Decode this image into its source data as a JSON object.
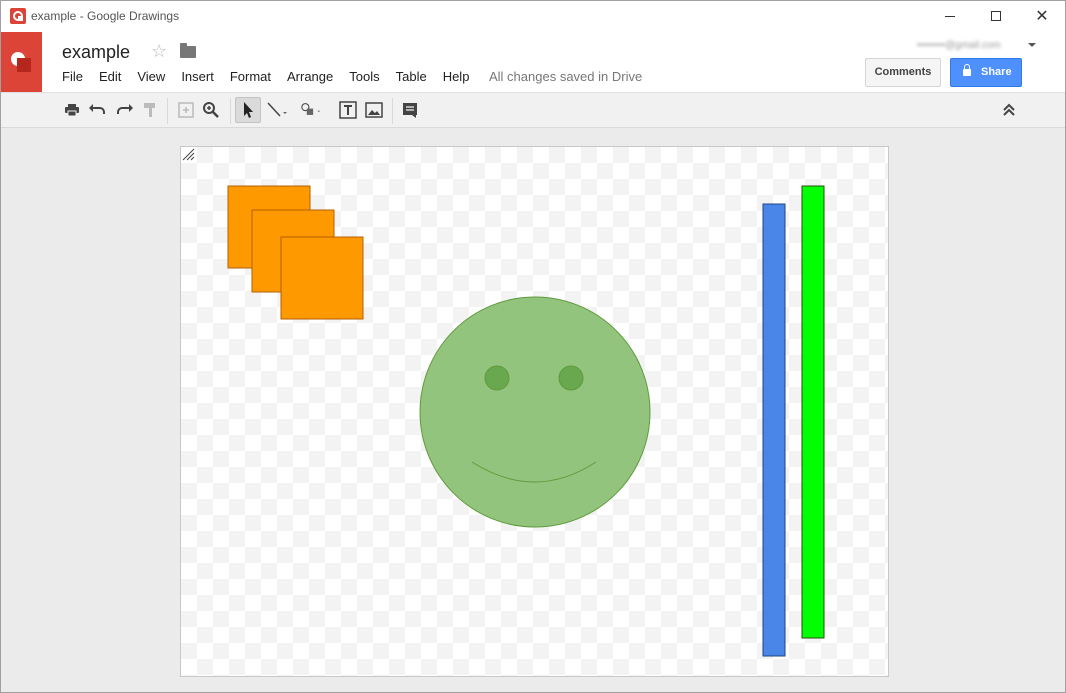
{
  "window": {
    "title": "example - Google Drawings"
  },
  "header": {
    "doc_title": "example",
    "menu": [
      "File",
      "Edit",
      "View",
      "Insert",
      "Format",
      "Arrange",
      "Tools",
      "Table",
      "Help"
    ],
    "save_status": "All changes saved in Drive",
    "account_email": "••••••••@gmail.com",
    "comments_label": "Comments",
    "share_label": "Share"
  },
  "toolbar": {
    "icons": [
      "print-icon",
      "undo-icon",
      "redo-icon",
      "paint-format-icon",
      "zoom-fit-icon",
      "zoom-icon",
      "select-icon",
      "line-icon",
      "shape-icon",
      "text-box-icon",
      "image-icon",
      "comment-icon",
      "collapse-icon"
    ]
  },
  "drawing": {
    "shapes": [
      {
        "kind": "square",
        "color": "#ff9900"
      },
      {
        "kind": "square",
        "color": "#ff9900"
      },
      {
        "kind": "square",
        "color": "#ff9900"
      },
      {
        "kind": "smiley-face",
        "color": "#93c47d"
      },
      {
        "kind": "vertical-bar",
        "color": "#4a86e8"
      },
      {
        "kind": "vertical-bar",
        "color": "#00ff00"
      }
    ]
  }
}
